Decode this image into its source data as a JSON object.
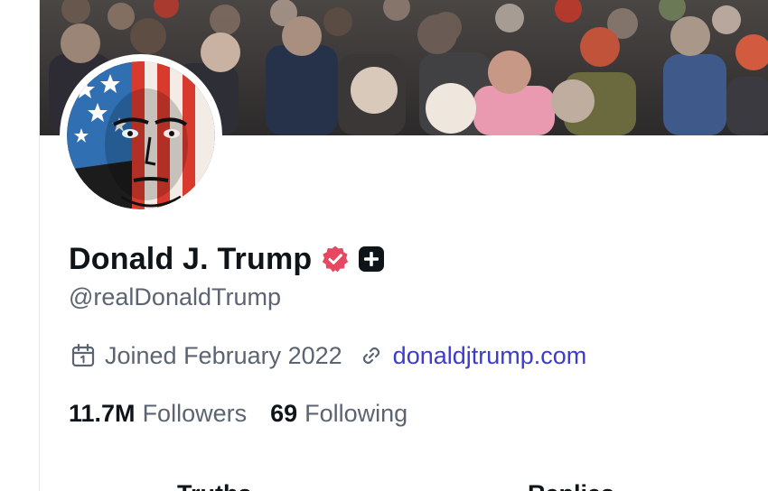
{
  "profile": {
    "display_name": "Donald J. Trump",
    "handle": "@realDonaldTrump",
    "joined": "Joined February 2022",
    "website": "donaldjtrump.com"
  },
  "stats": {
    "followers_count": "11.7M",
    "followers_label": "Followers",
    "following_count": "69",
    "following_label": "Following"
  },
  "icons": {
    "verified": "verified-badge-icon",
    "plus": "plus-badge-icon",
    "calendar": "calendar-icon",
    "link": "link-icon"
  },
  "tabs": [
    "Truths",
    "Replies"
  ],
  "colors": {
    "link": "#3d3bd0",
    "verified": "#e8485f",
    "secondary_text": "#5b6470"
  }
}
